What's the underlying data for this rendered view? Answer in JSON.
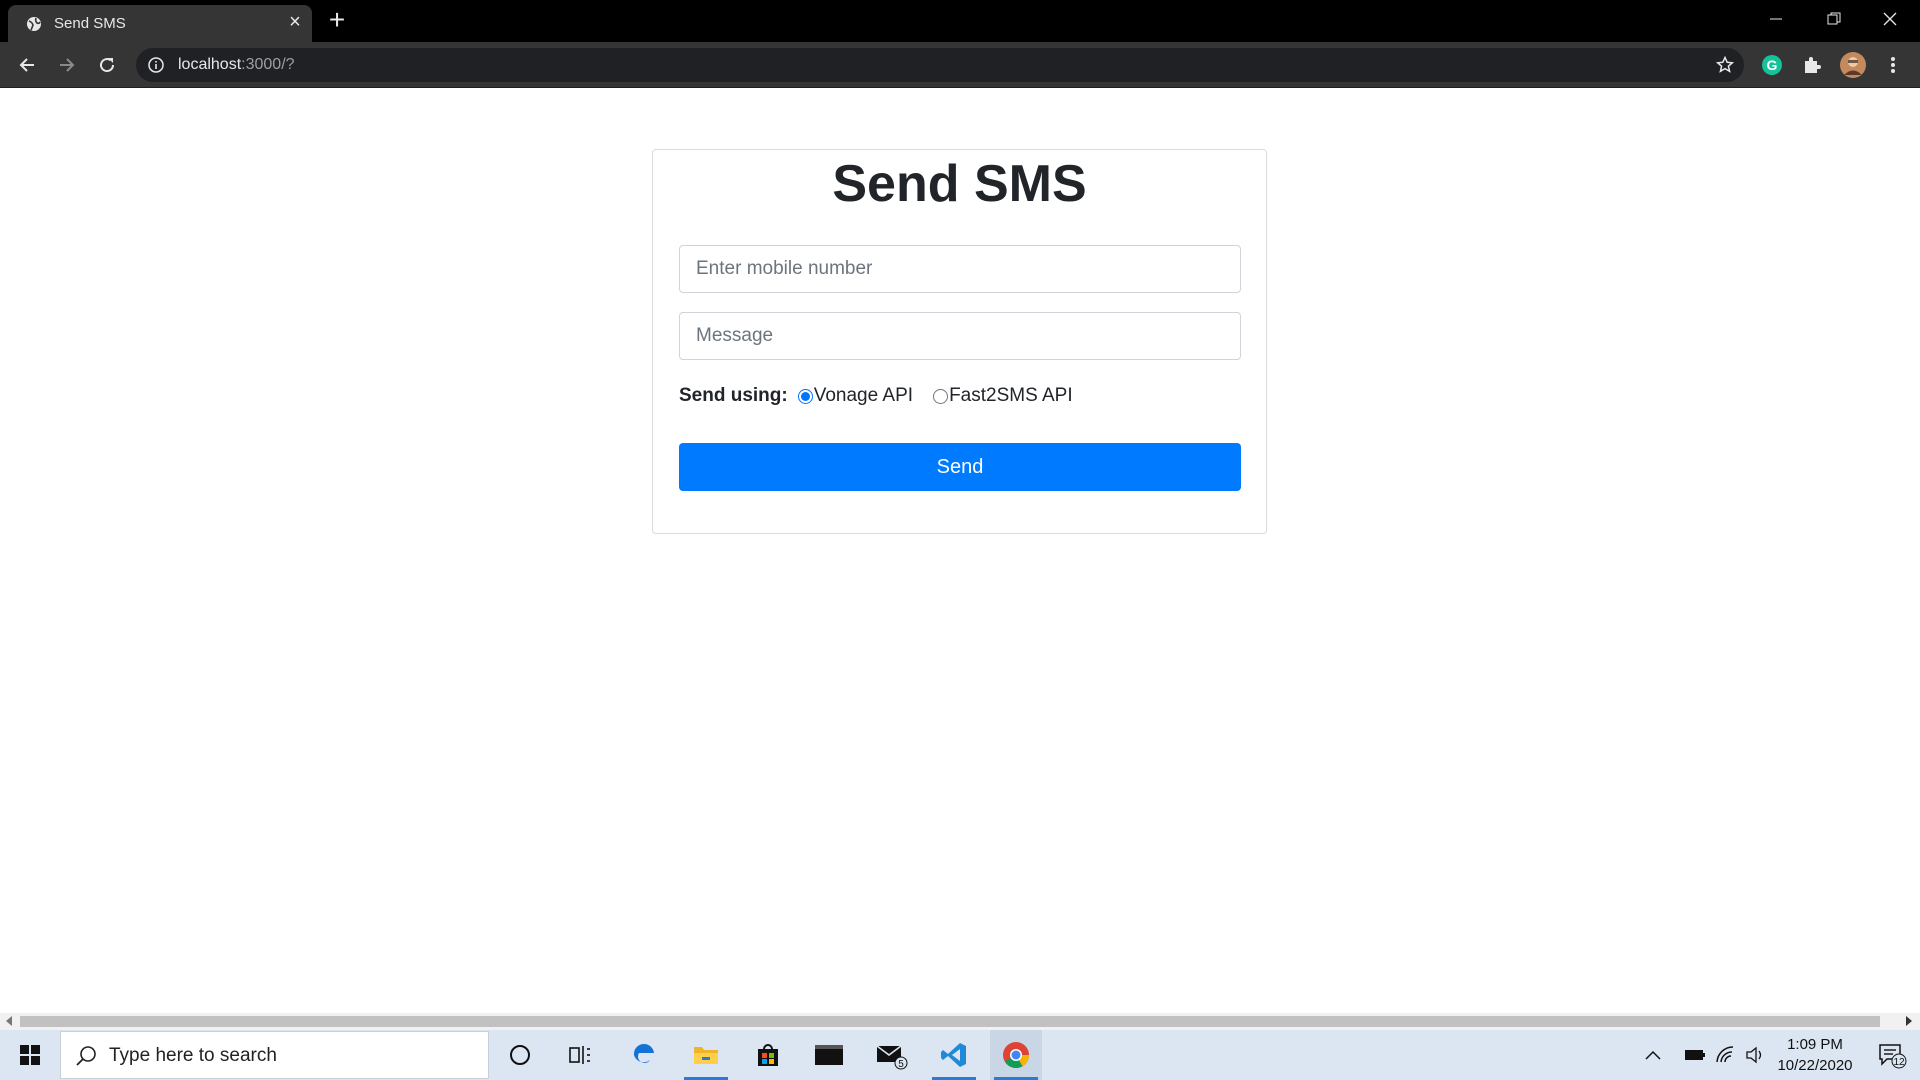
{
  "browser": {
    "tab_title": "Send SMS",
    "url_host": "localhost",
    "url_rest": ":3000/?"
  },
  "page": {
    "heading": "Send SMS",
    "mobile_placeholder": "Enter mobile number",
    "message_placeholder": "Message",
    "send_using_label": "Send using:",
    "options": [
      {
        "label": "Vonage API",
        "checked": true
      },
      {
        "label": "Fast2SMS API",
        "checked": false
      }
    ],
    "send_button": "Send"
  },
  "taskbar": {
    "search_placeholder": "Type here to search",
    "mail_badge": "5",
    "time": "1:09 PM",
    "date": "10/22/2020",
    "notifications": "12"
  },
  "colors": {
    "primary": "#007bff",
    "chrome_dark": "#353535",
    "taskbar": "#dce6f2"
  }
}
